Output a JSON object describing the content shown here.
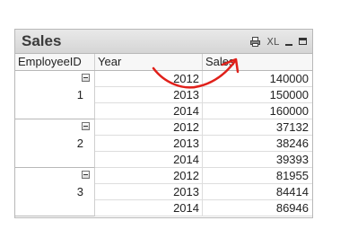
{
  "window": {
    "title": "Sales"
  },
  "caption_icons": [
    {
      "name": "print-icon"
    },
    {
      "name": "export-excel-icon",
      "label": "XL"
    },
    {
      "name": "minimize-icon"
    },
    {
      "name": "maximize-icon"
    }
  ],
  "table": {
    "headers": {
      "employee": "EmployeeID",
      "year": "Year",
      "sales": "Sales"
    },
    "groups": [
      {
        "employee": "1",
        "rows": [
          {
            "year": "2012",
            "sales": "140000"
          },
          {
            "year": "2013",
            "sales": "150000"
          },
          {
            "year": "2014",
            "sales": "160000"
          }
        ]
      },
      {
        "employee": "2",
        "rows": [
          {
            "year": "2012",
            "sales": "37132"
          },
          {
            "year": "2013",
            "sales": "38246"
          },
          {
            "year": "2014",
            "sales": "39393"
          }
        ]
      },
      {
        "employee": "3",
        "rows": [
          {
            "year": "2012",
            "sales": "81955"
          },
          {
            "year": "2013",
            "sales": "84414"
          },
          {
            "year": "2014",
            "sales": "86946"
          }
        ]
      }
    ]
  },
  "colors": {
    "annotation": "#e0201a",
    "caption_bg": "#dcdcdc"
  }
}
